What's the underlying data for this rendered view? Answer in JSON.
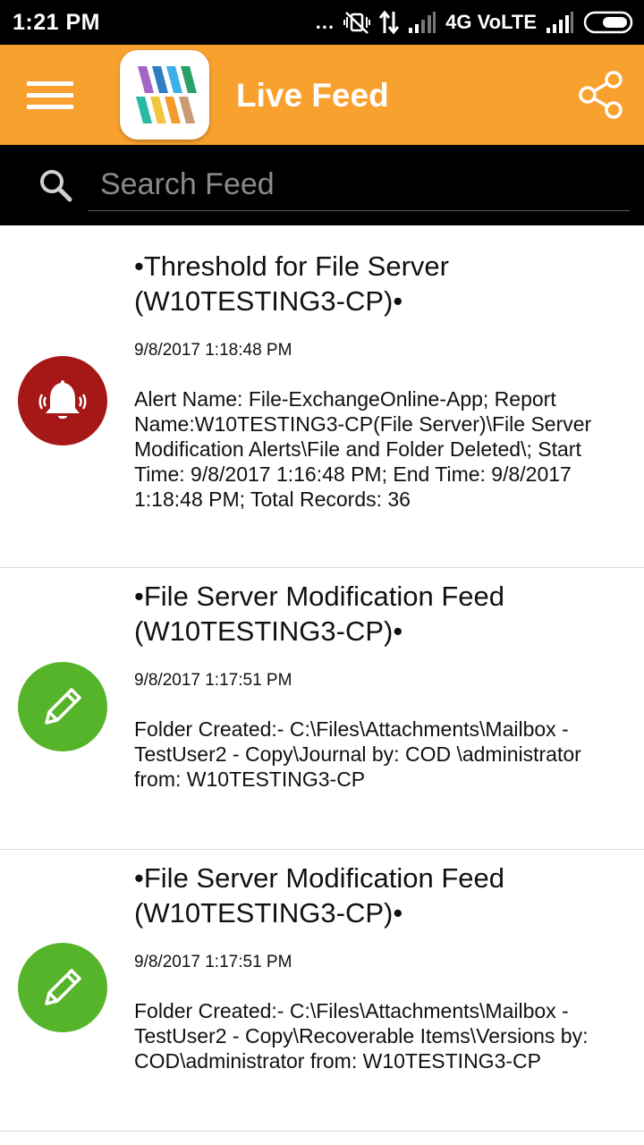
{
  "status_bar": {
    "time": "1:21 PM",
    "dots": "...",
    "network": "4G VoLTE"
  },
  "app_bar": {
    "title": "Live Feed"
  },
  "search": {
    "placeholder": "Search Feed",
    "value": ""
  },
  "feed": {
    "items": [
      {
        "icon": "bell-icon",
        "color": "#a61717",
        "title": "•Threshold for File Server (W10TESTING3-CP)•",
        "time": "9/8/2017 1:18:48 PM",
        "body": "Alert Name: File-ExchangeOnline-App; Report Name:W10TESTING3-CP(File Server)\\File Server Modification Alerts\\File and Folder Deleted\\; Start Time: 9/8/2017 1:16:48 PM; End Time: 9/8/2017 1:18:48 PM; Total Records: 36"
      },
      {
        "icon": "pencil-icon",
        "color": "#56b42a",
        "title": "•File Server Modification Feed (W10TESTING3-CP)•",
        "time": "9/8/2017 1:17:51 PM",
        "body": "Folder Created:- C:\\Files\\Attachments\\Mailbox - TestUser2 - Copy\\Journal by: COD \\administrator from: W10TESTING3-CP"
      },
      {
        "icon": "pencil-icon",
        "color": "#56b42a",
        "title": "•File Server Modification Feed (W10TESTING3-CP)•",
        "time": "9/8/2017 1:17:51 PM",
        "body": "Folder Created:- C:\\Files\\Attachments\\Mailbox - TestUser2 - Copy\\Recoverable Items\\Versions by: COD\\administrator from:  W10TESTING3-CP"
      }
    ]
  },
  "colors": {
    "app_bar": "#f9a12e",
    "status_bar": "#000000",
    "search_bar": "#000000",
    "alert_red": "#a61717",
    "edit_green": "#56b42a"
  }
}
